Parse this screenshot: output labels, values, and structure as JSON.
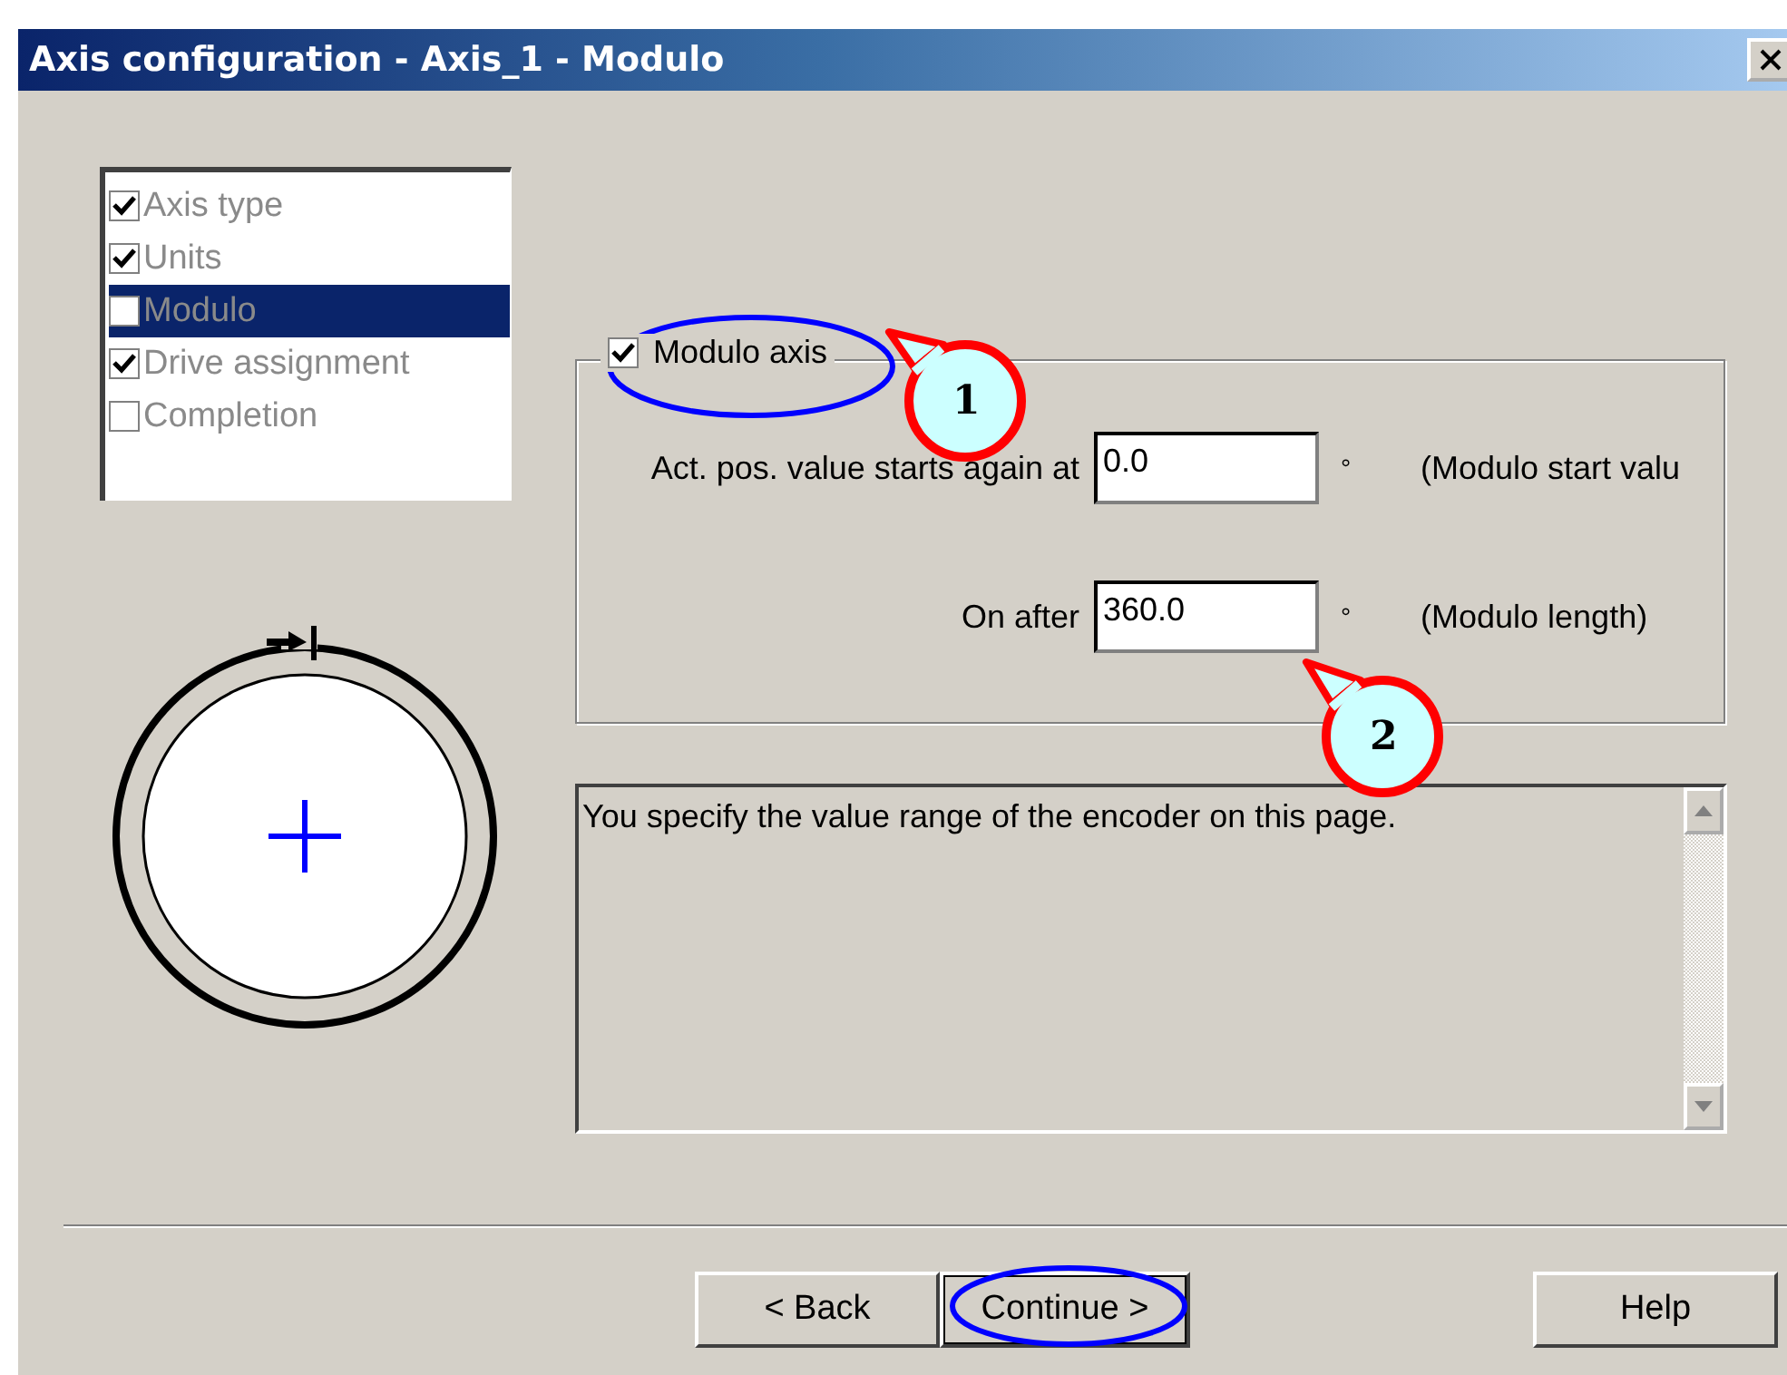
{
  "window": {
    "title": "Axis configuration - Axis_1 - Modulo"
  },
  "steps": [
    {
      "label": "Axis type",
      "checked": true,
      "selected": false
    },
    {
      "label": "Units",
      "checked": true,
      "selected": false
    },
    {
      "label": "Modulo",
      "checked": false,
      "selected": true
    },
    {
      "label": "Drive assignment",
      "checked": true,
      "selected": false
    },
    {
      "label": "Completion",
      "checked": false,
      "selected": false
    }
  ],
  "modulo_axis": {
    "label": "Modulo axis",
    "checked": true,
    "highlighted": true
  },
  "fields": [
    {
      "label": "Act. pos. value starts again at",
      "value": "0.0",
      "unit": "°",
      "note": "(Modulo start valu"
    },
    {
      "label": "On after",
      "value": "360.0",
      "unit": "°",
      "note": "(Modulo length)"
    }
  ],
  "message": "You specify the value range of the encoder on this page.",
  "buttons": [
    {
      "label": "< Back",
      "default": false,
      "highlighted": false
    },
    {
      "label": "Continue >",
      "default": true,
      "highlighted": true
    },
    {
      "label": "Help",
      "default": false,
      "highlighted": false
    }
  ],
  "callouts": [
    {
      "label": "1"
    },
    {
      "label": "2"
    }
  ]
}
